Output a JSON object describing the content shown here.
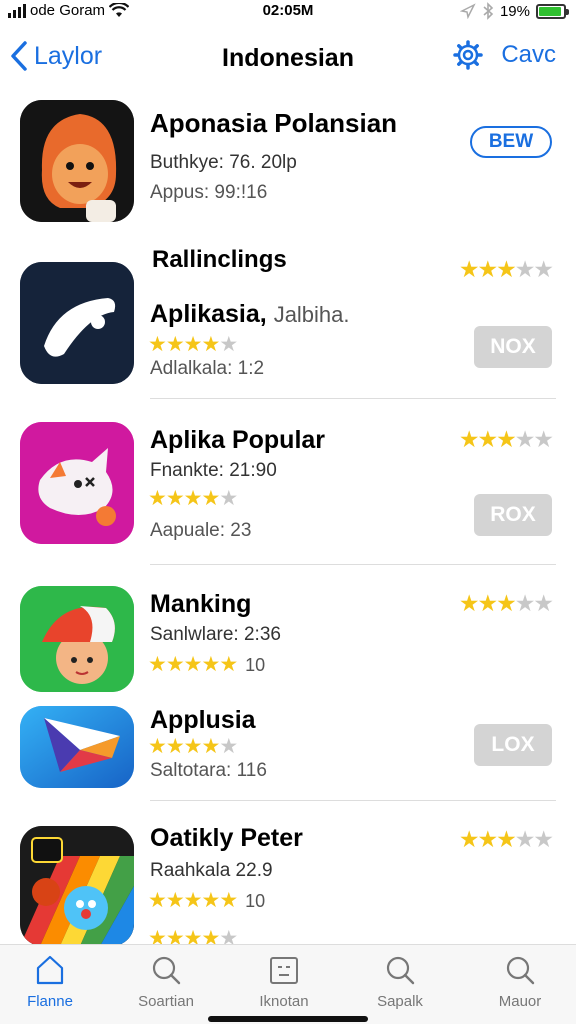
{
  "status": {
    "carrier": "ode Goram",
    "time": "02:05M",
    "battery": "19%",
    "battery_level": 0.9
  },
  "nav": {
    "back_label": "Laylor",
    "title": "Indonesian",
    "right_label": "Cavc"
  },
  "apps": [
    {
      "name": "Aponasia Polansian",
      "meta1": "Buthkye: 76. 20lp",
      "meta2": "Appus: 99:!16",
      "button": "BEW"
    },
    {
      "section": "Rallinclings",
      "name": "Aplikasia,",
      "name_extra": "Jalbiha.",
      "meta2": "Adlalkala: 1:2",
      "button": "NOX",
      "left_rating": 4,
      "right_rating": 2.5
    },
    {
      "name": "Aplika Popular",
      "meta1": "Fnankte: 21:90",
      "meta2": "Aapuale: 23",
      "button": "ROX",
      "left_rating": 4,
      "right_rating": 2.5
    },
    {
      "name": "Manking",
      "meta1": "Sanlwlare: 2:36",
      "count": "10",
      "left_rating": 4.5,
      "right_rating": 2.5
    },
    {
      "name": "Applusia",
      "meta2": "Saltotara: 116",
      "button": "LOX",
      "left_rating": 4
    },
    {
      "name": "Oatikly Peter",
      "meta1": "Raahkala 22.9",
      "count": "10",
      "left_rating": 4.5,
      "right_rating": 3,
      "extra_rating": 4
    }
  ],
  "tabs": [
    {
      "label": "Flanne",
      "icon": "home-icon"
    },
    {
      "label": "Soartian",
      "icon": "search-icon"
    },
    {
      "label": "Iknotan",
      "icon": "grid-icon"
    },
    {
      "label": "Sapalk",
      "icon": "search-icon"
    },
    {
      "label": "Mauor",
      "icon": "search-icon"
    }
  ],
  "colors": {
    "accent": "#1a6fe0",
    "star": "#f5c518",
    "star_off": "#c8c8c8",
    "button_gray": "#d4d4d4"
  }
}
